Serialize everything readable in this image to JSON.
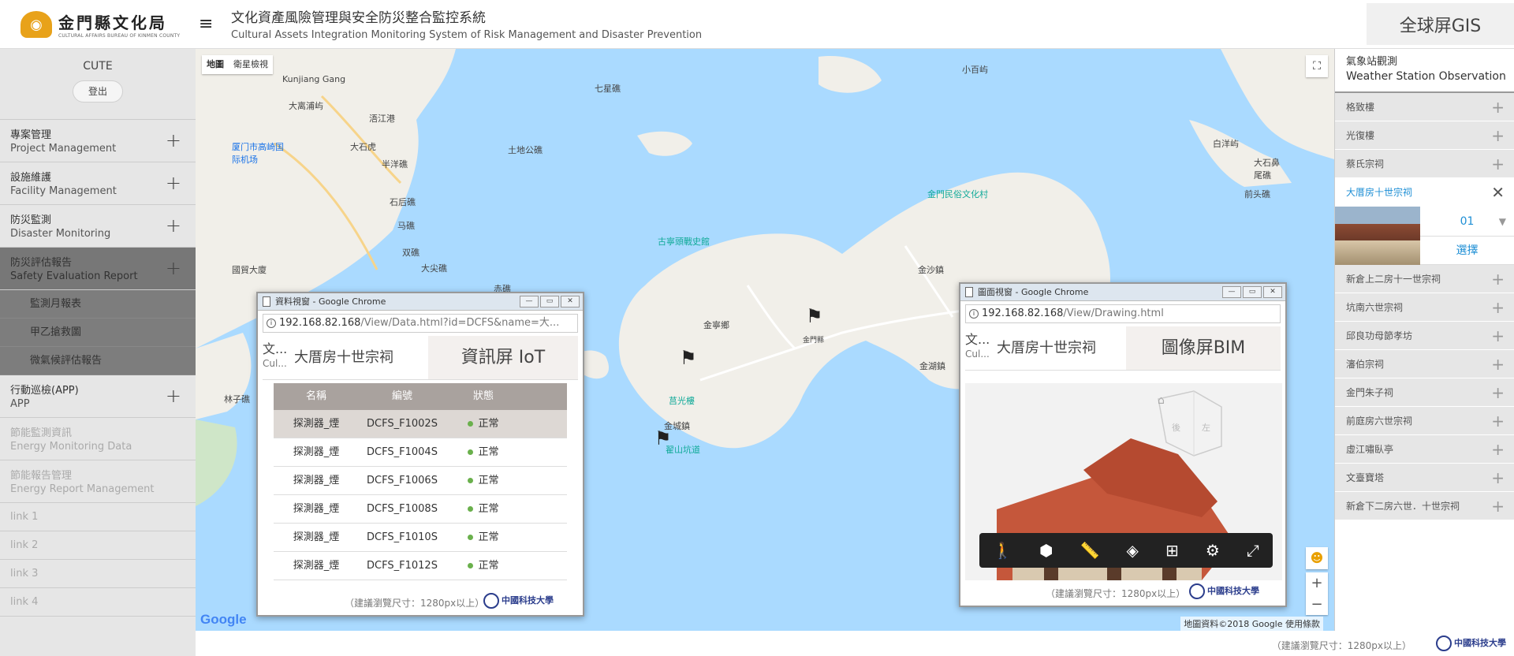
{
  "header": {
    "logo_cn": "金門縣文化局",
    "logo_en": "CULTURAL AFFAIRS BUREAU OF KINMEN COUNTY",
    "menu_icon": "≡",
    "title_cn": "文化資產風險管理與安全防災整合監控系統",
    "title_en": "Cultural Assets Integration Monitoring System of Risk Management and Disaster Prevention",
    "gis_button": "全球屏GIS"
  },
  "sidebar": {
    "user_name": "CUTE",
    "logout": "登出",
    "items": [
      {
        "cn": "專案管理",
        "en": "Project Management",
        "state": "normal"
      },
      {
        "cn": "設施維護",
        "en": "Facility Management",
        "state": "normal"
      },
      {
        "cn": "防災監測",
        "en": "Disaster Monitoring",
        "state": "normal"
      },
      {
        "cn": "防災評估報告",
        "en": "Safety Evaluation Report",
        "state": "active"
      }
    ],
    "subitems": [
      "監測月報表",
      "甲乙搶救圖",
      "微氣候評估報告"
    ],
    "items2": [
      {
        "cn": "行動巡檢(APP)",
        "en": "APP",
        "state": "normal"
      },
      {
        "cn": "節能監測資訊",
        "en": "Energy Monitoring Data",
        "state": "disabled"
      },
      {
        "cn": "節能報告管理",
        "en": "Energy Report Management",
        "state": "disabled"
      }
    ],
    "links": [
      "link 1",
      "link 2",
      "link 3",
      "link 4"
    ]
  },
  "map": {
    "type_map": "地圖",
    "type_satellite": "衛星檢視",
    "google": "Google",
    "attribution": "地圖資料©2018 Google   使用條款",
    "zoom_in": "+",
    "zoom_out": "−",
    "places": {
      "p1": "Kunjiang Gang",
      "p2": "大离浦屿",
      "p3": "厦门市高崎国际机场",
      "p4": "大石虎",
      "p5": "半洋礁",
      "p6": "石后礁",
      "p7": "马礁",
      "p8": "双礁",
      "p9": "大尖礁",
      "p10": "赤礁",
      "p11": "國貿大廈",
      "p12": "七星礁",
      "p13": "土地公礁",
      "p14": "小百屿",
      "p15": "白洋屿",
      "p16": "大石鼻尾礁",
      "p17": "前头礁",
      "p18": "金門民俗文化村",
      "p19": "古寧頭戰史館",
      "p20": "金寧鄉",
      "p21": "金沙鎮",
      "p22": "金湖鎮",
      "p23": "金門縣",
      "p24": "莒光樓",
      "p25": "金城鎮",
      "p26": "翟山坑道",
      "p27": "浯江港",
      "p28": "林子礁"
    }
  },
  "data_window": {
    "title": "資料視窗 - Google Chrome",
    "url_host": "192.168.82.168",
    "url_path": "/View/Data.html?id=DCFS&name=大...",
    "abbr": "文...",
    "abbr_sub": "Cul...",
    "site": "大厝房十世宗祠",
    "screen": "資訊屏 IoT",
    "columns": [
      "名稱",
      "編號",
      "狀態"
    ],
    "rows": [
      {
        "name": "探測器_煙",
        "code": "DCFS_F1002S",
        "status": "正常"
      },
      {
        "name": "探測器_煙",
        "code": "DCFS_F1004S",
        "status": "正常"
      },
      {
        "name": "探測器_煙",
        "code": "DCFS_F1006S",
        "status": "正常"
      },
      {
        "name": "探測器_煙",
        "code": "DCFS_F1008S",
        "status": "正常"
      },
      {
        "name": "探測器_煙",
        "code": "DCFS_F1010S",
        "status": "正常"
      },
      {
        "name": "探測器_煙",
        "code": "DCFS_F1012S",
        "status": "正常"
      }
    ],
    "hint": "（建議瀏覽尺寸：1280px以上）",
    "university": "中國科技大學"
  },
  "bim_window": {
    "title": "圖面視窗 - Google Chrome",
    "url_host": "192.168.82.168",
    "url_path": "/View/Drawing.html",
    "abbr": "文...",
    "abbr_sub": "Cul...",
    "site": "大厝房十世宗祠",
    "screen": "圖像屏BIM",
    "cube_left": "後",
    "cube_right": "左",
    "hint": "（建議瀏覽尺寸：1280px以上）",
    "university": "中國科技大學"
  },
  "right_panel": {
    "title_cn": "氣象站觀測",
    "title_en": "Weather Station Observation",
    "items_before": [
      "格致樓",
      "光復樓",
      "蔡氏宗祠"
    ],
    "open_item": "大厝房十世宗祠",
    "select_value": "01",
    "choose": "選擇",
    "items_after": [
      "新倉上二房十一世宗祠",
      "坑南六世宗祠",
      "邱良功母節孝坊",
      "瀋伯宗祠",
      "金門朱子祠",
      "前庭房六世宗祠",
      "虛江嘯臥亭",
      "文臺寶塔",
      "新倉下二房六世．十世宗祠"
    ]
  },
  "bottom": {
    "hint": "（建議瀏覽尺寸：1280px以上）",
    "university": "中國科技大學"
  }
}
